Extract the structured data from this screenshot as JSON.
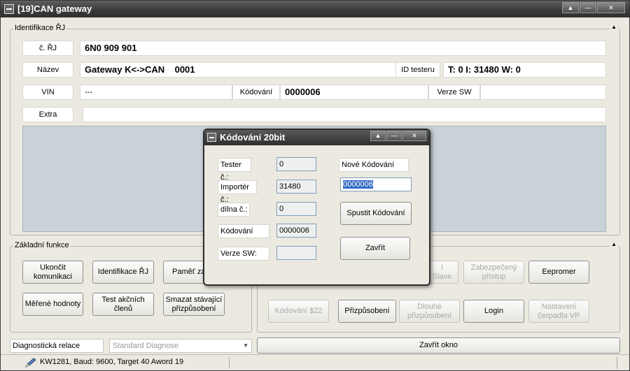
{
  "window": {
    "title": "[19]CAN gateway",
    "caption_buttons": [
      "▲",
      "—",
      "✕"
    ]
  },
  "ident": {
    "legend": "Identifikace ŘJ",
    "cislo_label": "č. ŘJ",
    "cislo_value": "6N0 909 901",
    "nazev_label": "Název",
    "nazev_value": "Gateway K<->CAN    0001",
    "id_testeru_label": "ID testeru",
    "id_testeru_value": "T: 0 I: 31480 W: 0",
    "vin_label": "VIN",
    "vin_value": "---",
    "kodovani_label": "Kódování",
    "kodovani_value": "0000006",
    "verze_sw_label": "Verze SW",
    "verze_sw_value": "",
    "extra_label": "Extra",
    "extra_value": ""
  },
  "basic": {
    "legend": "Základní funkce",
    "ukoncit": "Ukončit komunikaci",
    "identifikace": "Identifikace ŘJ",
    "pamet": "Paměť zá",
    "merene": "Měřené hodnoty",
    "test_clenu": "Test akčních členů",
    "smazat": "Smazat stávající přizpůsobení"
  },
  "advanced": {
    "slave": "i Slave",
    "zabezpeceny": "Zabezpečený přístup",
    "eepromer": "Eepromer",
    "kodovani22": "Kódování $22",
    "prizpusobeni": "Přizpůsobení",
    "dlouhe": "Dlouhé přizpůsobení",
    "login": "Login",
    "nastaveni": "Nastavení čerpadla VP"
  },
  "bottom": {
    "diag_label": "Diagnostická relace",
    "diag_value": "Standard Diagnose",
    "zavrit_okno": "Zavřít okno"
  },
  "statusbar": {
    "text": "KW1281, Baud: 9600, Target 40 Aword 19"
  },
  "dialog": {
    "title": "Kódování 20bit",
    "tester_label": "Tester č.:",
    "tester_value": "0",
    "importer_label": "Importér č.:",
    "importer_value": "31480",
    "dilna_label": "dílna č.:",
    "dilna_value": "0",
    "kodovani_label": "Kódování",
    "kodovani_value": "0000006",
    "verze_label": "Verze SW:",
    "verze_value": "",
    "nove_label": "Nové Kódování",
    "nove_value": "0000006",
    "spustit": "Spustit Kódování",
    "zavrit": "Zavřít"
  },
  "colors": {
    "titlebar": "#3b3b3b",
    "window_bg": "#ece9e0",
    "selection": "#316ac5"
  }
}
